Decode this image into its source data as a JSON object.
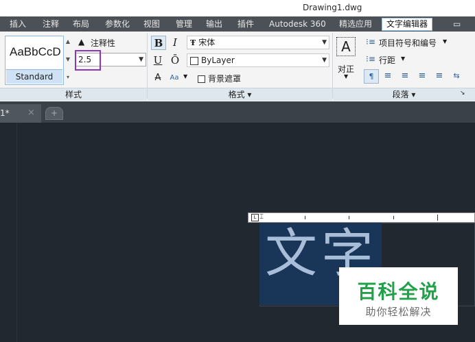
{
  "window": {
    "title": "Drawing1.dwg"
  },
  "menu": {
    "tabs": [
      "插入",
      "注释",
      "布局",
      "参数化",
      "视图",
      "管理",
      "输出",
      "插件",
      "Autodesk 360",
      "精选应用",
      "文字编辑器"
    ],
    "active_tab": "文字编辑器",
    "extra": "▭"
  },
  "ribbon": {
    "style": {
      "sample": "AaBbCcD",
      "name": "Standard",
      "annotative": "注释性",
      "height_value": "2.5",
      "footer": "样式"
    },
    "format": {
      "bold": "B",
      "italic": "I",
      "underline": "U",
      "overline": "Ō",
      "strike": "A",
      "case": "Aa",
      "font": "宋体",
      "color": "ByLayer",
      "mask": "背景遮罩",
      "footer": "格式 ▾"
    },
    "paragraph": {
      "justify": "对正",
      "bullets": "项目符号和编号",
      "line_spacing": "行距",
      "footer": "段落 ▾"
    }
  },
  "document_tabs": {
    "current_suffix": "1*",
    "close": "×"
  },
  "canvas": {
    "text": "文字",
    "watermark_main": "百科全说",
    "watermark_sub": "助你轻松解决"
  },
  "colors": {
    "accent": "#8c36b7",
    "canvas": "#212830",
    "selection": "#193659"
  }
}
